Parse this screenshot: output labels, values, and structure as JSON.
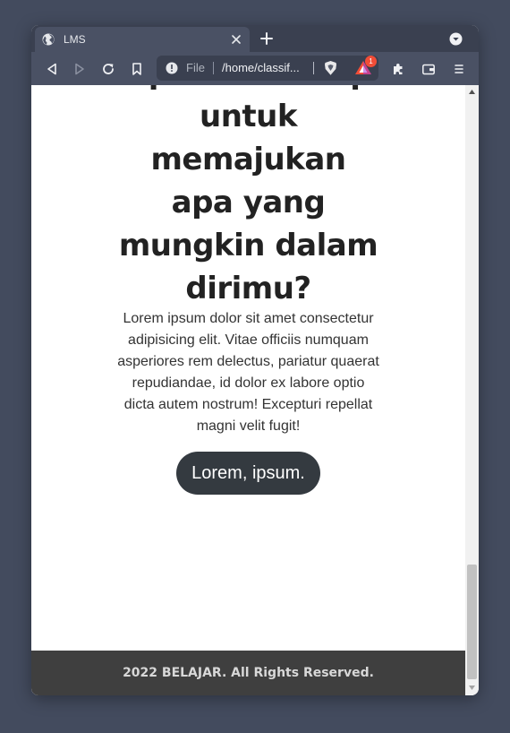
{
  "browser": {
    "tab_title": "LMS",
    "url_scheme_label": "File",
    "url_text": "/home/classif...",
    "rewards_badge_count": "1"
  },
  "hero": {
    "headline": "Apa kamu siap untuk memajukan apa yang mungkin dalam dirimu?",
    "paragraph": "Lorem ipsum dolor sit amet consectetur adipisicing elit. Vitae officiis numquam asperiores rem delectus, pariatur quaerat repudiandae, id dolor ex labore optio dicta autem nostrum! Excepturi repellat magni velit fugit!",
    "cta_label": "Lorem, ipsum."
  },
  "footer": {
    "text": "2022 BELAJAR. All Rights Reserved."
  },
  "colors": {
    "desktop_bg": "#434b5e",
    "toolbar_bg": "#4a5164",
    "cta_bg": "#343a40",
    "footer_bg": "#3f3f3f"
  }
}
